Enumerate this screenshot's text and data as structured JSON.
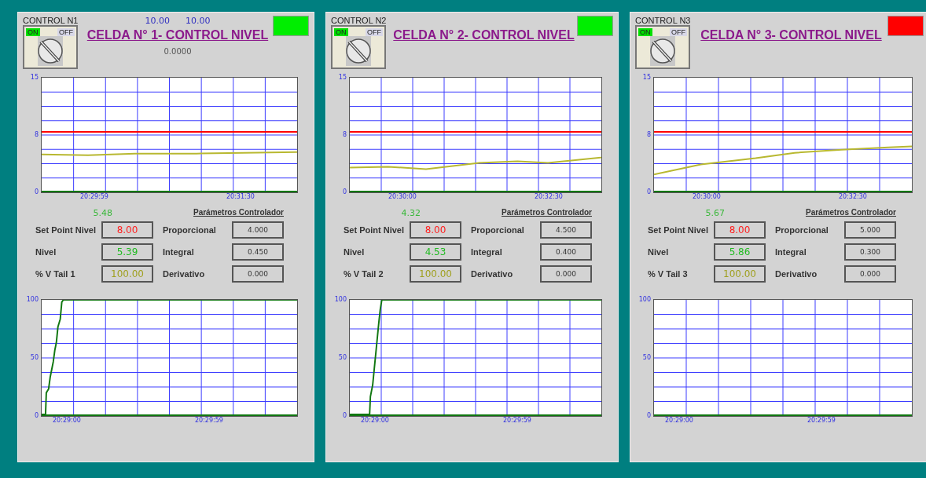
{
  "panels": [
    {
      "control_label": "CONTROL N1",
      "switch": {
        "on_label": "ON",
        "off_label": "OFF",
        "on": true
      },
      "title": "CELDA N° 1- CONTROL NIVEL",
      "indicator": {
        "color": "#00ee00"
      },
      "readouts": [
        "10.00",
        "10.00"
      ],
      "sub_readout": "0.0000",
      "level_chart": {
        "y_labels": [
          "15",
          "8",
          "0"
        ],
        "x_labels": [
          "20:29:59",
          "20:31:30"
        ]
      },
      "pv_readout": "5.48",
      "params_title": "Parámetros Controlador",
      "fields": [
        {
          "kind": "setpoint",
          "label": "Set Point Nivel",
          "value": "8.00"
        },
        {
          "kind": "level",
          "label": "Nivel",
          "value": "5.39"
        },
        {
          "kind": "valve",
          "label": "% V Tail 1",
          "value": "100.00"
        }
      ],
      "params": [
        {
          "label": "Proporcional",
          "value": "4.000"
        },
        {
          "label": "Integral",
          "value": "0.450"
        },
        {
          "label": "Derivativo",
          "value": "0.000"
        }
      ],
      "valve_chart": {
        "y_labels": [
          "100",
          "50",
          "0"
        ],
        "x_labels": [
          "20:29:00",
          "20:29:59"
        ]
      }
    },
    {
      "control_label": "CONTROL N2",
      "switch": {
        "on_label": "ON",
        "off_label": "OFF",
        "on": true
      },
      "title": "CELDA N° 2- CONTROL NIVEL",
      "indicator": {
        "color": "#00ee00"
      },
      "level_chart": {
        "y_labels": [
          "15",
          "8",
          "0"
        ],
        "x_labels": [
          "20:30:00",
          "20:32:30"
        ]
      },
      "pv_readout": "4.32",
      "params_title": "Parámetros Controlador",
      "fields": [
        {
          "kind": "setpoint",
          "label": "Set Point Nivel",
          "value": "8.00"
        },
        {
          "kind": "level",
          "label": "Nivel",
          "value": "4.53"
        },
        {
          "kind": "valve",
          "label": "% V Tail 2",
          "value": "100.00"
        }
      ],
      "params": [
        {
          "label": "Proporcional",
          "value": "4.500"
        },
        {
          "label": "Integral",
          "value": "0.400"
        },
        {
          "label": "Derivativo",
          "value": "0.000"
        }
      ],
      "valve_chart": {
        "y_labels": [
          "100",
          "50",
          "0"
        ],
        "x_labels": [
          "20:29:00",
          "20:29:59"
        ]
      }
    },
    {
      "control_label": "CONTROL N3",
      "switch": {
        "on_label": "ON",
        "off_label": "OFF",
        "on": true
      },
      "title": "CELDA N° 3- CONTROL NIVEL",
      "indicator": {
        "color": "#ff0000"
      },
      "level_chart": {
        "y_labels": [
          "15",
          "8",
          "0"
        ],
        "x_labels": [
          "20:30:00",
          "20:32:30"
        ]
      },
      "pv_readout": "5.67",
      "params_title": "Parámetros Controlador",
      "fields": [
        {
          "kind": "setpoint",
          "label": "Set Point Nivel",
          "value": "8.00"
        },
        {
          "kind": "level",
          "label": "Nivel",
          "value": "5.86"
        },
        {
          "kind": "valve",
          "label": "% V Tail 3",
          "value": "100.00"
        }
      ],
      "params": [
        {
          "label": "Proporcional",
          "value": "5.000"
        },
        {
          "label": "Integral",
          "value": "0.300"
        },
        {
          "label": "Derivativo",
          "value": "0.000"
        }
      ],
      "valve_chart": {
        "y_labels": [
          "100",
          "50",
          "0"
        ],
        "x_labels": [
          "20:29:00",
          "20:29:59"
        ]
      }
    }
  ]
}
